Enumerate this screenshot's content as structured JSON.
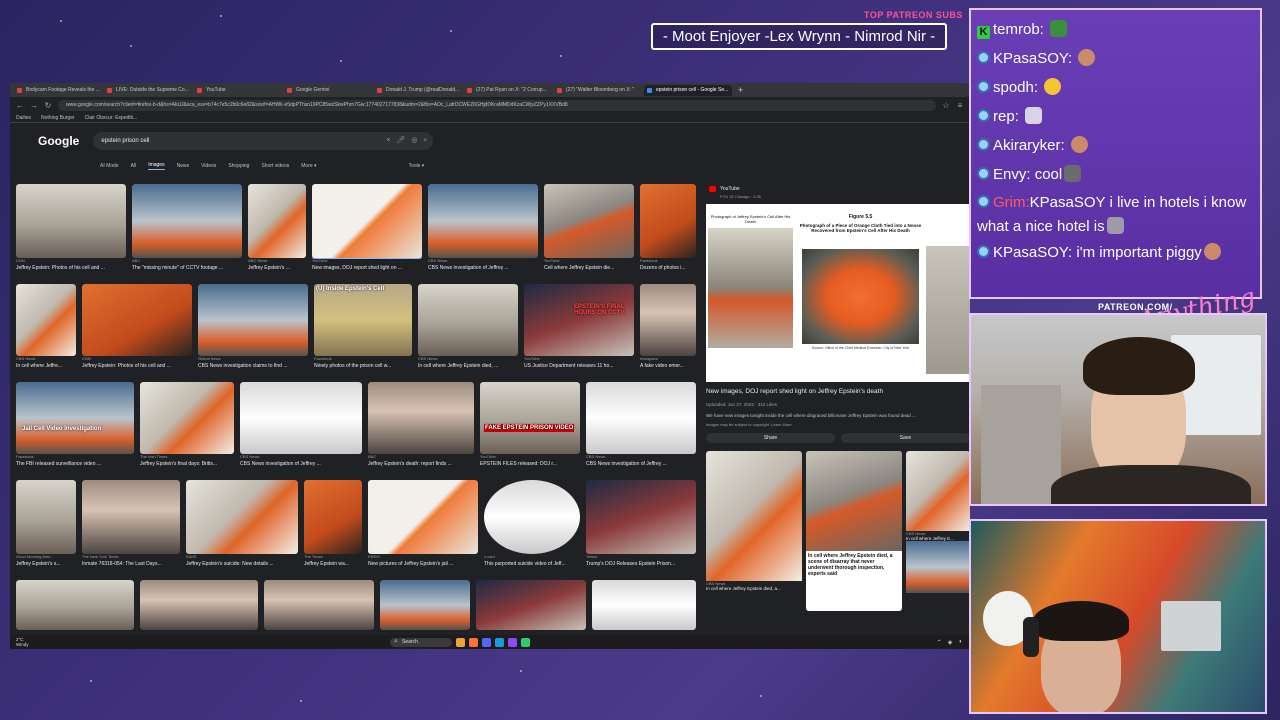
{
  "overlay": {
    "subs_header": "TOP PATREON SUBS",
    "subs_names": "- Moot Enjoyer -Lex Wrynn - Nimrod Nir -",
    "patreon_label": "PATREON.COM/",
    "signature": "Anything Else?"
  },
  "browser": {
    "tabs": [
      "Bodycam Footage Reveals the ...",
      "LIVE: Outside the Supreme Co...",
      "YouTube",
      "Google Gemini",
      "Donald J. Trump (@realDonald...",
      "(27) Pat Ryan on X: \"2 Corrup...",
      "(27) \"Walter Bloomberg on X: \"",
      "epstein prison cell - Google Se..."
    ],
    "url": "www.google.com/search?client=firefox-b-d&hs=AkUJ&sca_esv=b74c7e5c2b0c6e82&sxsrf=AHWk-e5dpPThsn19PC85wzSkwPhrn7Gw:1774027177838&udm=2&fbs=AOc_LafrDCWEZ6GHjdDKraMMDdKzaCWjvZZPy1XXVBd8",
    "bookmarks": [
      "Dailies",
      "Nothing Burger",
      "Clair Obscur: Expediti..."
    ],
    "google_logo": "Google",
    "search_query": "epstein prison cell",
    "search_tabs": [
      "AI Mode",
      "All",
      "Images",
      "News",
      "Videos",
      "Shopping",
      "Short videos",
      "More ▾"
    ],
    "tools": "Tools ▾"
  },
  "results": [
    {
      "src": "CNN",
      "cap": "Jeffrey Epstein: Photos of his cell and ..."
    },
    {
      "src": "ABC",
      "cap": "The \"missing minute\" of CCTV footage ..."
    },
    {
      "src": "ABC News",
      "cap": "Jeffrey Epstein's ..."
    },
    {
      "src": "YouTube",
      "cap": "New images, DOJ report shed light on ..."
    },
    {
      "src": "CBS News",
      "cap": "CBS News investigation of Jeffrey ..."
    },
    {
      "src": "YouTube",
      "cap": "Cell where Jeffrey Epstein die..."
    },
    {
      "src": "Facebook",
      "cap": "Dozens of photos i..."
    },
    {
      "src": "CBS News",
      "cap": "In cell where Jeffre..."
    },
    {
      "src": "CNN",
      "cap": "Jeffrey Epstein: Photos of his cell and ..."
    },
    {
      "src": "Global News",
      "cap": "CBS News investigation claims to find ..."
    },
    {
      "src": "Facebook",
      "cap": "Ninety photos of the prison cell w..."
    },
    {
      "src": "CBS News",
      "cap": "In cell where Jeffrey Epstein died, ..."
    },
    {
      "src": "YouTube",
      "cap": "US Justice Department releases 11 ho..."
    },
    {
      "src": "Instagram",
      "cap": "A fake video emer..."
    },
    {
      "src": "Facebook",
      "cap": "The FBI released surveillance video ..."
    },
    {
      "src": "The Irish Times",
      "cap": "Jeffrey Epstein's final days: Britis..."
    },
    {
      "src": "CBS News",
      "cap": "CBS News investigation of Jeffrey ..."
    },
    {
      "src": "BBC",
      "cap": "Jeffrey Epstein's death: report finds ..."
    },
    {
      "src": "YouTube",
      "cap": "EPSTEIN FILES released: DOJ r..."
    },
    {
      "src": "CBS News",
      "cap": "CBS News investigation of Jeffrey ..."
    },
    {
      "src": "Good Morning Ame...",
      "cap": "Jeffrey Epstein's s..."
    },
    {
      "src": "The New York Times",
      "cap": "Inmate 76318-054: The Last Days..."
    },
    {
      "src": "KAKE",
      "cap": "Jeffrey Epstein's suicide: New details ..."
    },
    {
      "src": "The Times",
      "cap": "Jeffrey Epstein wa..."
    },
    {
      "src": "KREM",
      "cap": "New pictures of Jeffrey Epstein's jail ..."
    },
    {
      "src": "x.com",
      "cap": "This purported suicide video of Jeff..."
    },
    {
      "src": "Yahoo",
      "cap": "Trump's DOJ Releases Epstein Prison..."
    }
  ],
  "overlay_text": {
    "jail_cell": "Jail Cell Video Investigation",
    "inside_cell": "(U) Inside Epstein's Cell",
    "final_hours": "EPSTEIN'S FINAL HOURS ON CCTV",
    "fake_video": "FAKE EPSTEIN PRISON VIDEO"
  },
  "panel": {
    "source": "YouTube",
    "sub": "FOX 32 Chicago · 2:26",
    "fig_left_title": "Photograph of Jeffrey Epstein's Cell After His Death",
    "fig_number": "Figure 5.5",
    "fig_title": "Photograph of a Piece of Orange Cloth Tied into a Noose Recovered from Epstein's Cell After His Death",
    "fig_source": "Source: Office of the Chief Medical Examiner, City of New York",
    "title": "New images, DOJ report shed light on Jeffrey Epstein's death",
    "meta": "Uploaded: Jun 27, 2023 · 342 Likes",
    "desc": "We have new images tonight inside the cell where disgraced billionaire Jeffrey Epstein was found dead ...",
    "note": "Images may be subject to copyright. Learn More",
    "share": "Share",
    "save": "Save",
    "related_src": "CBS News",
    "related_cap": "In cell where Jeffrey Epstein died, a...",
    "related_headline": "In cell where Jeffrey Epstein died, a scene of disarray that never underwent thorough inspection, experts said",
    "related2_cap": "In cell where Jeffrey E..."
  },
  "taskbar": {
    "weather_temp": "2°C",
    "weather_desc": "Windy",
    "search": "Search"
  },
  "chat": [
    {
      "user": "temrob:",
      "msg": "",
      "badge": "k"
    },
    {
      "user": "KPasaSOY:",
      "msg": "",
      "badge": "b"
    },
    {
      "user": "spodh:",
      "msg": "",
      "badge": "b"
    },
    {
      "user": "rep:",
      "msg": "",
      "badge": "b"
    },
    {
      "user": "Akiraryker:",
      "msg": "",
      "badge": "b"
    },
    {
      "user": "Envy:",
      "msg": "cool",
      "badge": "b"
    },
    {
      "user": "Grim:",
      "msg": "KPasaSOY i live in hotels i know what a nice hotel is",
      "badge": "b"
    },
    {
      "user": "KPasaSOY:",
      "msg": "i'm important piggy",
      "badge": "b"
    }
  ]
}
